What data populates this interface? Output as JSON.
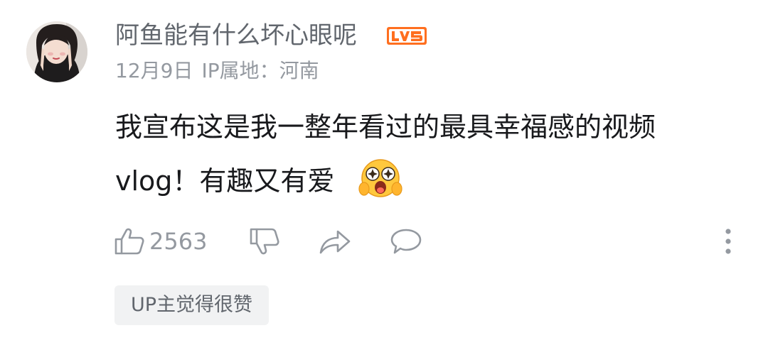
{
  "comment": {
    "username": "阿鱼能有什么坏心眼呢",
    "level_badge": "LV5",
    "date": "12月9日",
    "location": "IP属地：河南",
    "body_line1": "我宣布这是我一整年看过的最具幸福感的视频",
    "body_line2": "vlog！有趣又有爱",
    "emoji": "starry-eyed-face-emoji",
    "like_count": "2563",
    "up_tag": "UP主觉得很赞"
  },
  "icons": {
    "like": "thumbs-up-icon",
    "dislike": "thumbs-down-icon",
    "share": "share-arrow-icon",
    "reply": "speech-bubble-icon",
    "more": "vertical-ellipsis-icon"
  },
  "colors": {
    "username": "#61666d",
    "meta": "#9499a0",
    "body": "#18191c",
    "level_badge": "#ff6f1f",
    "tag_background": "#f1f2f3"
  }
}
